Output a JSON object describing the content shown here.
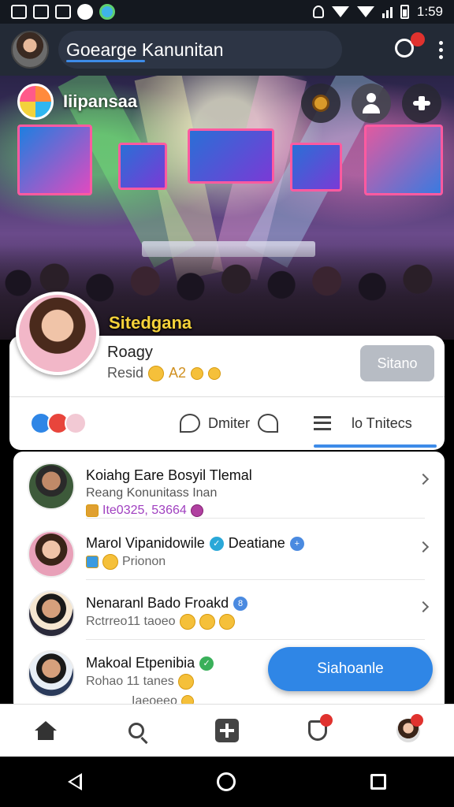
{
  "status_bar": {
    "time": "1:59"
  },
  "header": {
    "search_text": "Goearge Kanunitan",
    "notification_badge": ""
  },
  "banner": {
    "group_name": "Iiipansaa",
    "profile_handle": "Sitedgana"
  },
  "profile": {
    "name": "Roagy",
    "meta": "Resid",
    "meta_suffix": "A2",
    "follow_label": "Sitano"
  },
  "actions": {
    "comment_label": "Dmiter",
    "list_label": "lo Tnitecs"
  },
  "list": [
    {
      "title": "Koiahg Eare Bosyil Tlemal",
      "subtitle": "Reang Konunitass Inan",
      "meta": "Ite0325, 53664"
    },
    {
      "title": "Marol Vipanidowile",
      "title_suffix": "Deatiane",
      "meta": "Prionon"
    },
    {
      "title": "Nenaranl Bado Froakd",
      "meta": "Rctrreo11 taoeo"
    },
    {
      "title": "Makoal Etpenibia",
      "meta": "Rohao 11 tanes",
      "meta2": "Iaeoeeo"
    }
  ],
  "cta": {
    "label": "Siahoanle"
  },
  "colors": {
    "accent": "#2f86e6",
    "header_bg": "#232a36",
    "handle_yellow": "#f5d23a",
    "badge_red": "#e0322e"
  },
  "icons": [
    "home-icon",
    "search-icon",
    "add-icon",
    "shield-icon",
    "profile-avatar"
  ]
}
